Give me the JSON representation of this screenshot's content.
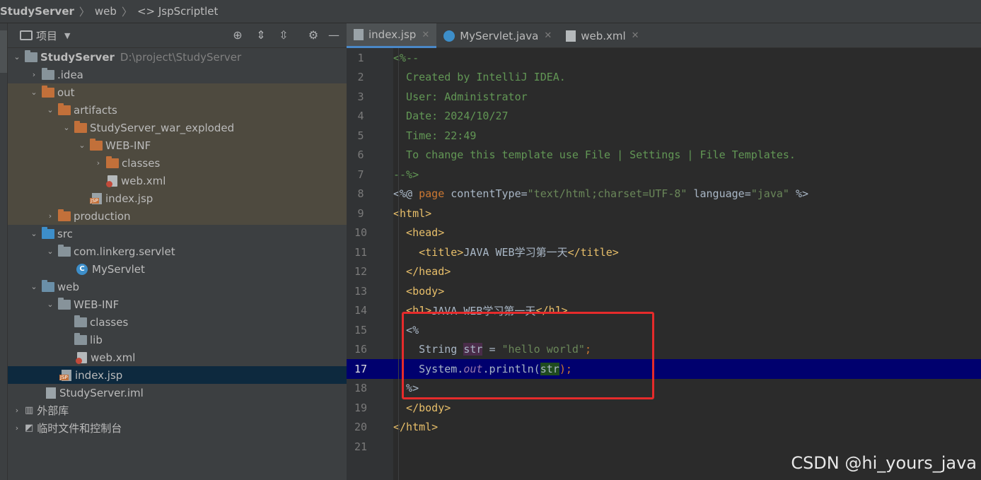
{
  "breadcrumb": {
    "root": "StudyServer",
    "sep1": "〉",
    "web": "web",
    "sep2": "〉",
    "file": "<> JspScriptlet"
  },
  "panel": {
    "title": "项目"
  },
  "tree": [
    {
      "label": "StudyServer",
      "path": "D:\\project\\StudyServer"
    },
    {
      "label": ".idea"
    },
    {
      "label": "out"
    },
    {
      "label": "artifacts"
    },
    {
      "label": "StudyServer_war_exploded"
    },
    {
      "label": "WEB-INF"
    },
    {
      "label": "classes"
    },
    {
      "label": "web.xml"
    },
    {
      "label": "index.jsp"
    },
    {
      "label": "production"
    },
    {
      "label": "src"
    },
    {
      "label": "com.linkerg.servlet"
    },
    {
      "label": "MyServlet"
    },
    {
      "label": "web"
    },
    {
      "label": "WEB-INF"
    },
    {
      "label": "classes"
    },
    {
      "label": "lib"
    },
    {
      "label": "web.xml"
    },
    {
      "label": "index.jsp"
    },
    {
      "label": "StudyServer.iml"
    },
    {
      "label": "外部库"
    },
    {
      "label": "临时文件和控制台"
    }
  ],
  "tabs": [
    {
      "label": "index.jsp"
    },
    {
      "label": "MyServlet.java"
    },
    {
      "label": "web.xml"
    }
  ],
  "lines": {
    "n1": "1",
    "n2": "2",
    "n3": "3",
    "n4": "4",
    "n5": "5",
    "n6": "6",
    "n7": "7",
    "n8": "8",
    "n9": "9",
    "n10": "10",
    "n11": "11",
    "n12": "12",
    "n13": "13",
    "n14": "14",
    "n15": "15",
    "n16": "16",
    "n17": "17",
    "n18": "18",
    "n19": "19",
    "n20": "20",
    "n21": "21",
    "l1": "<%--",
    "l2": "  Created by IntelliJ IDEA.",
    "l3": "  User: Administrator",
    "l4": "  Date: 2024/10/27",
    "l5": "  Time: 22:49",
    "l6": "  To change this template use File | Settings | File Templates.",
    "l7": "--%>",
    "l8a": "<%@ ",
    "l8b": "page ",
    "l8c": "contentType=",
    "l8d": "\"text/html;charset=UTF-8\"",
    "l8e": " language=",
    "l8f": "\"java\"",
    "l8g": " %>",
    "l9": "<html>",
    "l10": "  <head>",
    "l11a": "    <title>",
    "l11b": "JAVA WEB学习第一天",
    "l11c": "</title>",
    "l12": "  </head>",
    "l13": "  <body>",
    "l14a": "  <h1>",
    "l14b": "JAVA WEB学习第一天",
    "l14c": "</h1>",
    "l15": "  <%",
    "l16a": "    String ",
    "l16b": "str",
    "l16c": " = ",
    "l16d": "\"hello world\"",
    "l16e": ";",
    "l17a": "    System.",
    "l17b": "out",
    "l17c": ".println(",
    "l17d": "str",
    "l17e": ");",
    "l18": "  %>",
    "l19": "  </body>",
    "l20": "</html>"
  },
  "watermark": "CSDN @hi_yours_java"
}
